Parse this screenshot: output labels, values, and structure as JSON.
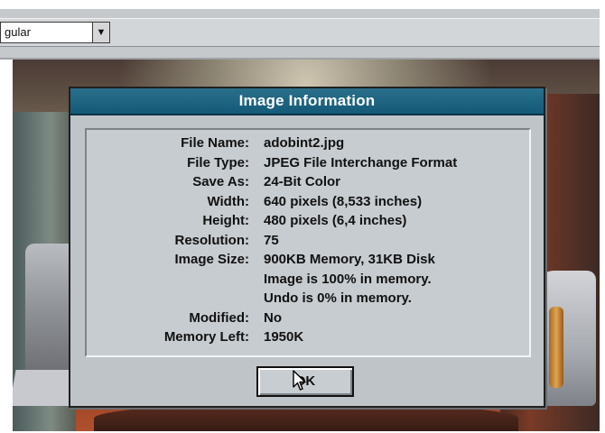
{
  "toolbar": {
    "combo_value": "gular",
    "combo_arrow": "▼"
  },
  "dialog": {
    "title": "Image Information",
    "fields": [
      {
        "label": "File Name:",
        "value": "adobint2.jpg"
      },
      {
        "label": "File Type:",
        "value": "JPEG File Interchange Format"
      },
      {
        "label": "Save As:",
        "value": "24-Bit Color"
      },
      {
        "label": "Width:",
        "value": "640 pixels (8,533 inches)"
      },
      {
        "label": "Height:",
        "value": "480 pixels (6,4 inches)"
      },
      {
        "label": "Resolution:",
        "value": "75"
      },
      {
        "label": "Image Size:",
        "value": "900KB Memory, 31KB Disk"
      },
      {
        "label": "",
        "value": "Image is 100% in memory."
      },
      {
        "label": "",
        "value": "Undo is 0% in memory."
      },
      {
        "label": "Modified:",
        "value": "No"
      },
      {
        "label": "Memory Left:",
        "value": "1950K"
      }
    ],
    "ok_label": "OK"
  },
  "icons": {
    "cursor": "mouse-pointer-icon",
    "combo_dropdown": "chevron-down-icon"
  },
  "colors": {
    "title_bar": "#145a78",
    "title_text": "#ffffff",
    "dialog_bg": "#bfc4c8"
  }
}
